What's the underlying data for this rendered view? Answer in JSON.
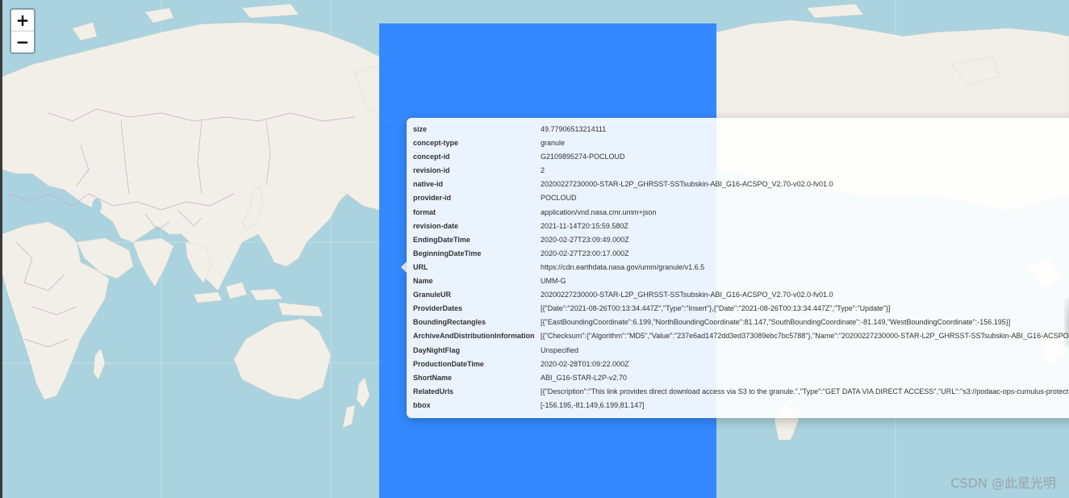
{
  "zoom": {
    "in_label": "+",
    "out_label": "−"
  },
  "watermark": "CSDN @此星光明",
  "colors": {
    "water": "#aad3df",
    "land": "#f2efe9",
    "bbox_fill": "#3388ff",
    "border": "#c9a9c9"
  },
  "popup": {
    "rows": [
      {
        "key": "size",
        "value": "49.77906513214111"
      },
      {
        "key": "concept-type",
        "value": "granule"
      },
      {
        "key": "concept-id",
        "value": "G2109895274-POCLOUD"
      },
      {
        "key": "revision-id",
        "value": "2"
      },
      {
        "key": "native-id",
        "value": "20200227230000-STAR-L2P_GHRSST-SSTsubskin-ABI_G16-ACSPO_V2.70-v02.0-fv01.0"
      },
      {
        "key": "provider-id",
        "value": "POCLOUD"
      },
      {
        "key": "format",
        "value": "application/vnd.nasa.cmr.umm+json"
      },
      {
        "key": "revision-date",
        "value": "2021-11-14T20:15:59.580Z"
      },
      {
        "key": "EndingDateTime",
        "value": "2020-02-27T23:09:49.000Z"
      },
      {
        "key": "BeginningDateTime",
        "value": "2020-02-27T23:00:17.000Z"
      },
      {
        "key": "URL",
        "value": "https://cdn.earthdata.nasa.gov/umm/granule/v1.6.5"
      },
      {
        "key": "Name",
        "value": "UMM-G"
      },
      {
        "key": "GranuleUR",
        "value": "20200227230000-STAR-L2P_GHRSST-SSTsubskin-ABI_G16-ACSPO_V2.70-v02.0-fv01.0"
      },
      {
        "key": "ProviderDates",
        "value": "[{\"Date\":\"2021-08-26T00:13:34.447Z\",\"Type\":\"Insert\"},{\"Date\":\"2021-08-26T00:13:34.447Z\",\"Type\":\"Update\"}]"
      },
      {
        "key": "BoundingRectangles",
        "value": "[{\"EastBoundingCoordinate\":6.199,\"NorthBoundingCoordinate\":81.147,\"SouthBoundingCoordinate\":-81.149,\"WestBoundingCoordinate\":-156.195}]"
      },
      {
        "key": "ArchiveAndDistributionInformation",
        "value": "[{\"Checksum\":{\"Algorithm\":\"MD5\",\"Value\":\"237e6ad1472dd3ed373089ebc7bc5788\"},\"Name\":\"20200227230000-STAR-L2P_GHRSST-SSTsubskin-ABI_G16-ACSPO"
      },
      {
        "key": "DayNightFlag",
        "value": "Unspecified"
      },
      {
        "key": "ProductionDateTime",
        "value": "2020-02-28T01:09:22.000Z"
      },
      {
        "key": "ShortName",
        "value": "ABI_G16-STAR-L2P-v2.70"
      },
      {
        "key": "RelatedUrls",
        "value": "[{\"Description\":\"This link provides direct download access via S3 to the granule.\",\"Type\":\"GET DATA VIA DIRECT ACCESS\",\"URL\":\"s3://podaac-ops-cumulus-protect"
      },
      {
        "key": "bbox",
        "value": "[-156.195,-81.149,6.199,81.147]"
      }
    ]
  }
}
